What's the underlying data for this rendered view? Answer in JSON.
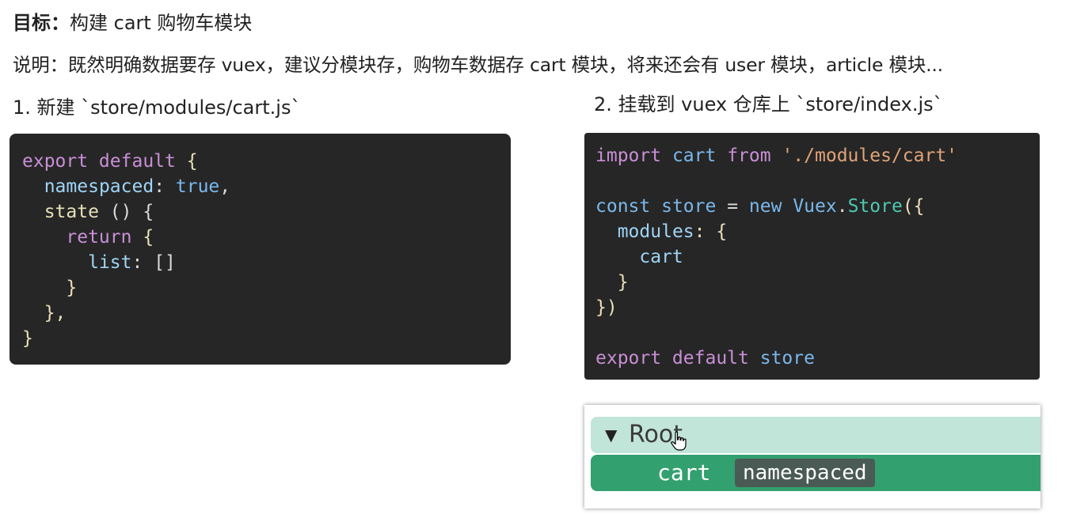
{
  "header": {
    "title_label": "目标：",
    "title_text": "构建 cart 购物车模块",
    "description": "说明：既然明确数据要存 vuex，建议分模块存，购物车数据存 cart 模块，将来还会有 user 模块，article 模块...",
    "step1": "1. 新建 `store/modules/cart.js`",
    "step2": "2. 挂载到 vuex 仓库上 `store/index.js`"
  },
  "code1": {
    "l1_kw": "export default",
    "l1_brace": " {",
    "l2_key": "namespaced",
    "l2_colon": ": ",
    "l2_val": "true",
    "l2_comma": ",",
    "l3_key": "state",
    "l3_rest": " () {",
    "l4_kw": "return",
    "l4_brace": " {",
    "l5_key": "list",
    "l5_colon": ": ",
    "l5_val": "[]",
    "l6": "}",
    "l7": "},",
    "l8": "}"
  },
  "code2": {
    "l1_import": "import",
    "l1_cart": "cart",
    "l1_from": "from",
    "l1_path": "'./modules/cart'",
    "l3_const": "const",
    "l3_store": "store",
    "l3_eq": " = ",
    "l3_new": "new",
    "l3_vuex": "Vuex",
    "l3_dot": ".",
    "l3_storecls": "Store",
    "l3_open": "({",
    "l4_key": "modules",
    "l4_rest": ": {",
    "l5_cart": "cart",
    "l6": "}",
    "l7": "})",
    "l9_kw": "export default",
    "l9_store": "store"
  },
  "devtools": {
    "root_arrow": "▼",
    "root_label": "Root",
    "cart_label": "cart",
    "badge_label": "namespaced",
    "colors": {
      "root_row_bg": "#c1e5d8",
      "cart_row_bg": "#33a06f",
      "badge_bg": "#4a5a55"
    }
  },
  "icons": {
    "cursor": "hand-pointer-icon"
  }
}
